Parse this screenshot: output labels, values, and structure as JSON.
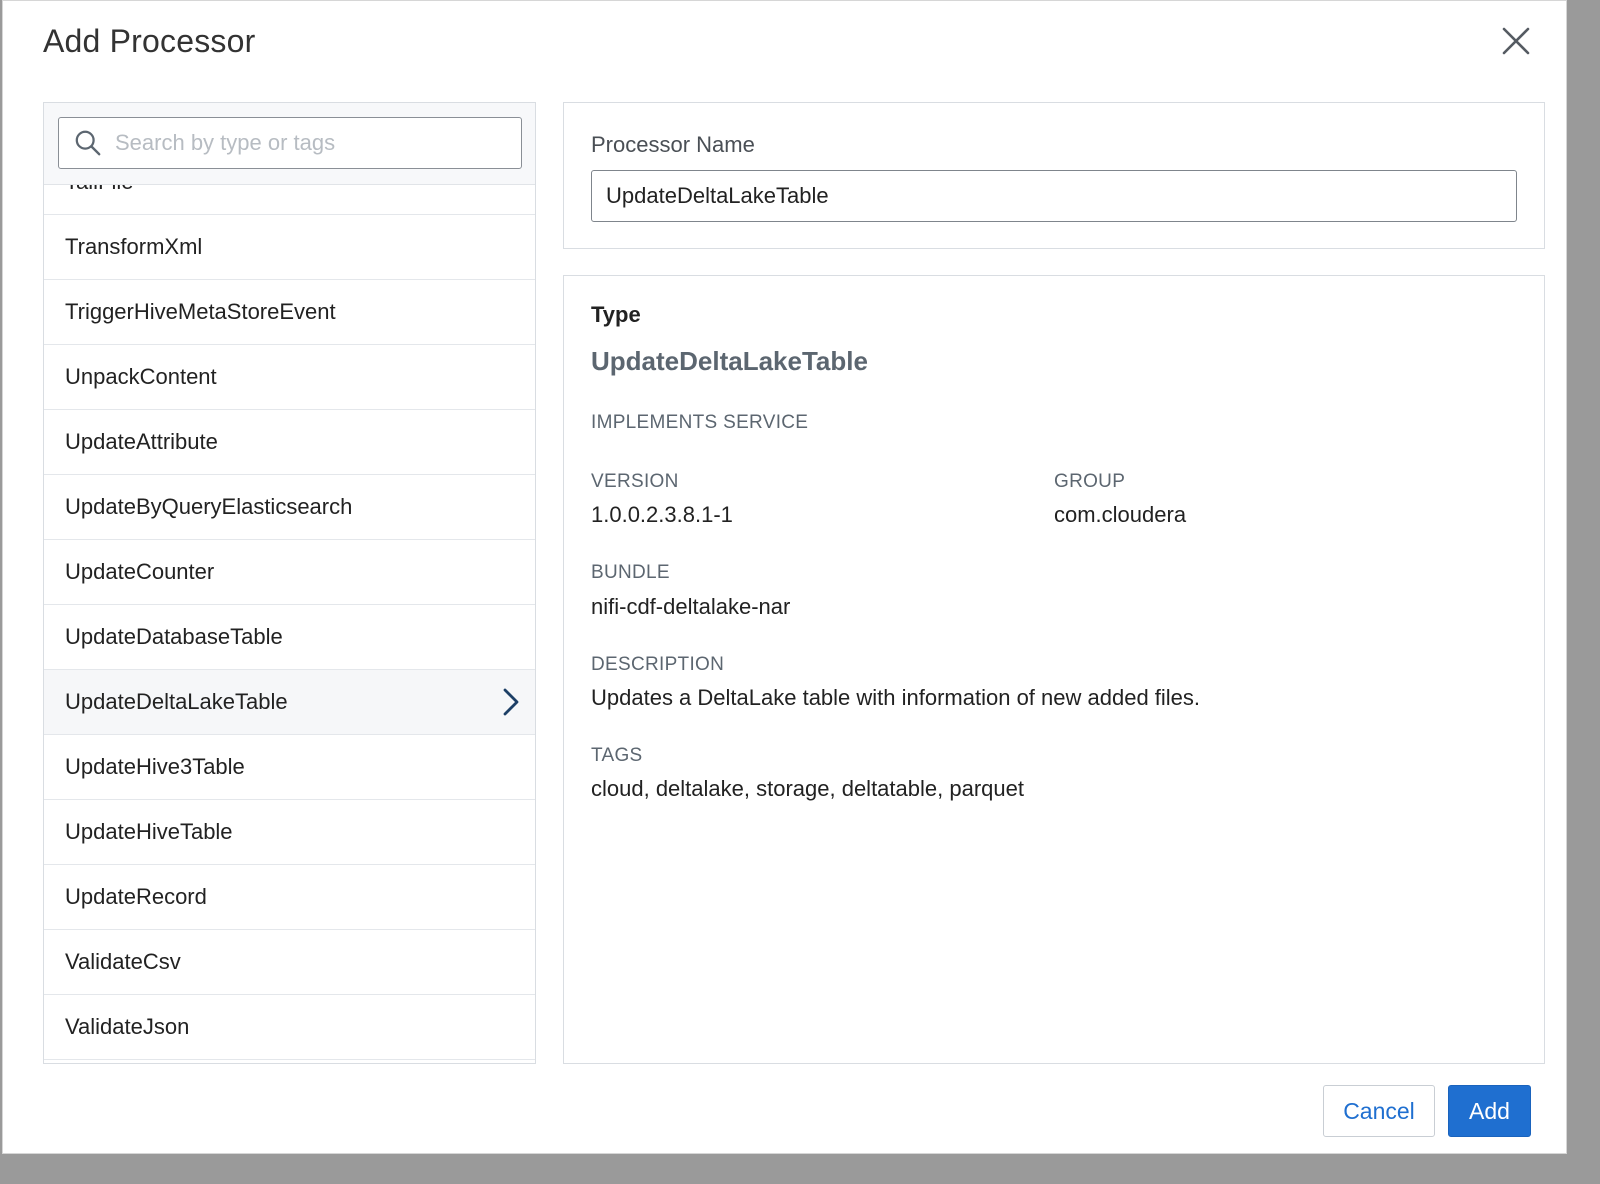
{
  "dialog": {
    "title": "Add Processor",
    "close_icon": "close-icon"
  },
  "search": {
    "placeholder": "Search by type or tags",
    "value": "",
    "icon": "search-icon"
  },
  "processor_list": {
    "items": [
      "TailFile",
      "TransformXml",
      "TriggerHiveMetaStoreEvent",
      "UnpackContent",
      "UpdateAttribute",
      "UpdateByQueryElasticsearch",
      "UpdateCounter",
      "UpdateDatabaseTable",
      "UpdateDeltaLakeTable",
      "UpdateHive3Table",
      "UpdateHiveTable",
      "UpdateRecord",
      "ValidateCsv",
      "ValidateJson"
    ],
    "selected": "UpdateDeltaLakeTable",
    "selected_icon": "chevron-right-icon"
  },
  "processor_name": {
    "label": "Processor Name",
    "value": "UpdateDeltaLakeTable"
  },
  "details": {
    "type_heading": "Type",
    "type_value": "UpdateDeltaLakeTable",
    "implements_label": "IMPLEMENTS SERVICE",
    "version_label": "VERSION",
    "version_value": "1.0.0.2.3.8.1-1",
    "group_label": "GROUP",
    "group_value": "com.cloudera",
    "bundle_label": "BUNDLE",
    "bundle_value": "nifi-cdf-deltalake-nar",
    "description_label": "DESCRIPTION",
    "description_value": "Updates a DeltaLake table with information of new added files.",
    "tags_label": "TAGS",
    "tags_value": "cloud, deltalake, storage, deltatable, parquet"
  },
  "footer": {
    "cancel_label": "Cancel",
    "add_label": "Add"
  },
  "colors": {
    "primary": "#1f6fd0",
    "muted_text": "#5c6670"
  }
}
